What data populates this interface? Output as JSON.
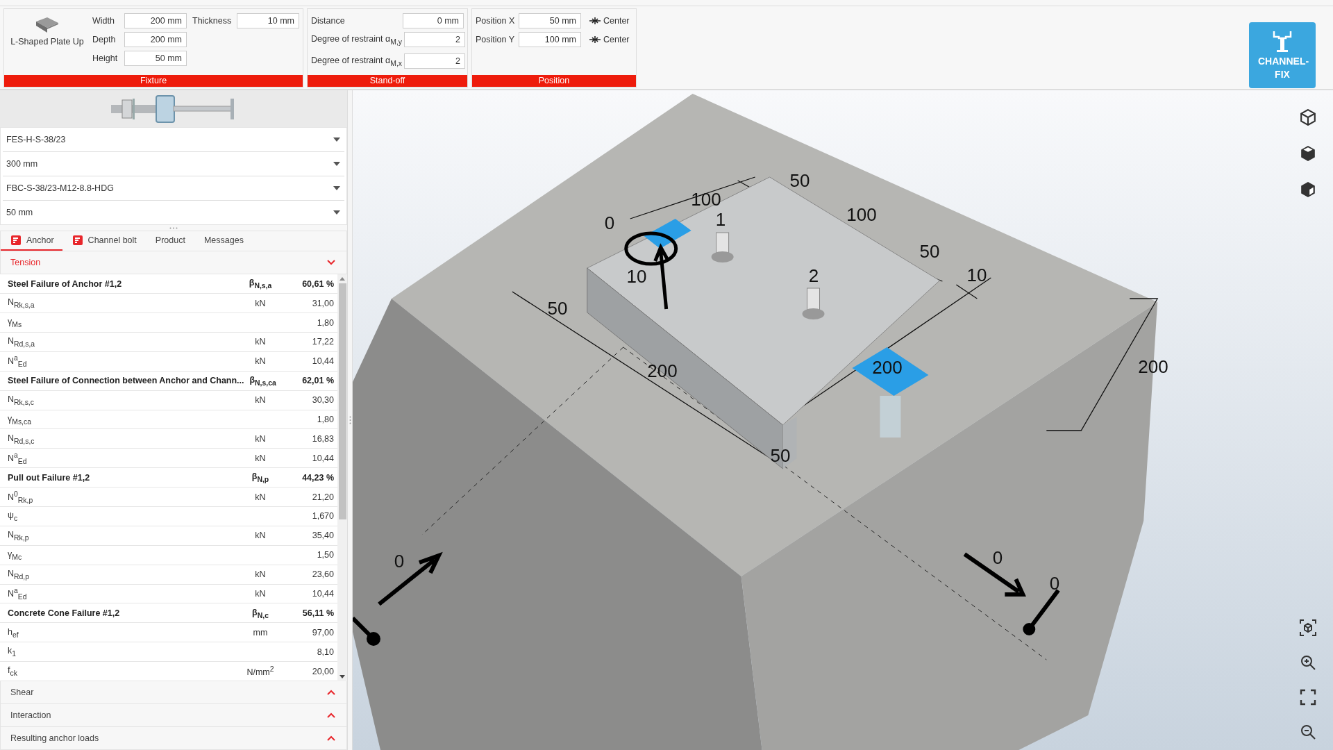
{
  "fixture": {
    "title": "Fixture",
    "type_label": "L-Shaped Plate Up",
    "columns": [
      [
        {
          "label": "Width",
          "value": "200 mm"
        },
        {
          "label": "Depth",
          "value": "200 mm"
        },
        {
          "label": "Height",
          "value": "50 mm"
        }
      ],
      [
        {
          "label": "Thickness",
          "value": "10 mm"
        }
      ]
    ]
  },
  "standoff": {
    "title": "Stand-off",
    "fields": [
      {
        "label": "Distance",
        "value": "0 mm"
      },
      {
        "label": "Degree of restraint α$_{M,y}$",
        "value": "2"
      },
      {
        "label": "Degree of restraint α$_{M,x}$",
        "value": "2"
      }
    ]
  },
  "position": {
    "title": "Position",
    "fields": [
      {
        "label": "Position X",
        "value": "50 mm",
        "action": "Center"
      },
      {
        "label": "Position Y",
        "value": "100 mm",
        "action": "Center"
      }
    ]
  },
  "logo": {
    "text": "CHANNEL-FIX"
  },
  "selects": [
    "FES-H-S-38/23",
    "300 mm",
    "FBC-S-38/23-M12-8.8-HDG",
    "50 mm"
  ],
  "result_tabs": [
    {
      "label": "Anchor",
      "icon": true,
      "selected": true
    },
    {
      "label": "Channel bolt",
      "icon": true,
      "selected": false
    },
    {
      "label": "Product",
      "icon": false,
      "selected": false
    },
    {
      "label": "Messages",
      "icon": false,
      "selected": false
    }
  ],
  "sections": [
    {
      "title": "Tension",
      "expanded": true,
      "rows": [
        {
          "kind": "header",
          "label": "Steel Failure of Anchor #1,2",
          "unit": "β$_{N,s,a}$",
          "value": "60,61 %"
        },
        {
          "kind": "value",
          "label": "N$_{Rk,s,a}$",
          "unit": "kN",
          "value": "31,00"
        },
        {
          "kind": "value",
          "label": "γ$_{Ms}$",
          "unit": "",
          "value": "1,80"
        },
        {
          "kind": "value",
          "label": "N$_{Rd,s,a}$",
          "unit": "kN",
          "value": "17,22"
        },
        {
          "kind": "value",
          "label": "N$^{a}$$_{Ed}$",
          "unit": "kN",
          "value": "10,44"
        },
        {
          "kind": "header",
          "label": "Steel Failure of Connection between Anchor and Chann...",
          "unit": "β$_{N,s,ca}$",
          "value": "62,01 %"
        },
        {
          "kind": "value",
          "label": "N$_{Rk,s,c}$",
          "unit": "kN",
          "value": "30,30"
        },
        {
          "kind": "value",
          "label": "γ$_{Ms,ca}$",
          "unit": "",
          "value": "1,80"
        },
        {
          "kind": "value",
          "label": "N$_{Rd,s,c}$",
          "unit": "kN",
          "value": "16,83"
        },
        {
          "kind": "value",
          "label": "N$^{a}$$_{Ed}$",
          "unit": "kN",
          "value": "10,44"
        },
        {
          "kind": "header",
          "label": "Pull out Failure #1,2",
          "unit": "β$_{N,p}$",
          "value": "44,23 %"
        },
        {
          "kind": "value",
          "label": "N$^{0}$$_{Rk,p}$",
          "unit": "kN",
          "value": "21,20"
        },
        {
          "kind": "value",
          "label": "ψ$_{c}$",
          "unit": "",
          "value": "1,670"
        },
        {
          "kind": "value",
          "label": "N$_{Rk,p}$",
          "unit": "kN",
          "value": "35,40"
        },
        {
          "kind": "value",
          "label": "γ$_{Mc}$",
          "unit": "",
          "value": "1,50"
        },
        {
          "kind": "value",
          "label": "N$_{Rd,p}$",
          "unit": "kN",
          "value": "23,60"
        },
        {
          "kind": "value",
          "label": "N$^{a}$$_{Ed}$",
          "unit": "kN",
          "value": "10,44"
        },
        {
          "kind": "header",
          "label": "Concrete Cone Failure #1,2",
          "unit": "β$_{N,c}$",
          "value": "56,11 %"
        },
        {
          "kind": "value",
          "label": "h$_{ef}$",
          "unit": "mm",
          "value": "97,00"
        },
        {
          "kind": "value",
          "label": "k$_{1}$",
          "unit": "",
          "value": "8,10"
        },
        {
          "kind": "value",
          "label": "f$_{ck}$",
          "unit": "N/mm$^{2}$",
          "value": "20,00"
        }
      ]
    },
    {
      "title": "Shear",
      "expanded": false
    },
    {
      "title": "Interaction",
      "expanded": false
    },
    {
      "title": "Resulting anchor loads",
      "expanded": false
    }
  ],
  "viewport": {
    "dimension_labels": [
      "0",
      "100",
      "50",
      "1",
      "100",
      "50",
      "10",
      "2",
      "10",
      "50",
      "200",
      "200",
      "200",
      "50",
      "0",
      "0",
      "0"
    ]
  }
}
